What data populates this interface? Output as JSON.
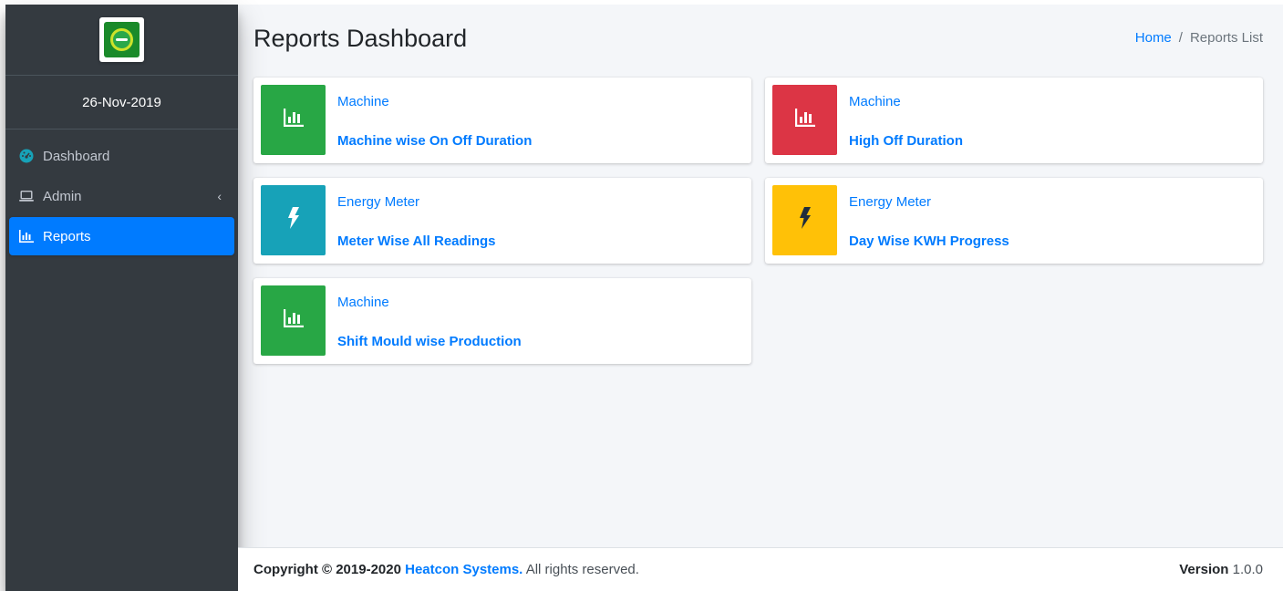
{
  "sidebar": {
    "logo_icon": "company-logo",
    "date": "26-Nov-2019",
    "items": [
      {
        "label": "Dashboard",
        "icon": "tachometer-icon"
      },
      {
        "label": "Admin",
        "icon": "laptop-icon"
      },
      {
        "label": "Reports",
        "icon": "bar-chart-icon"
      }
    ]
  },
  "header": {
    "title": "Reports Dashboard",
    "breadcrumb": {
      "home": "Home",
      "separator": "/",
      "current": "Reports List"
    }
  },
  "reports": [
    {
      "category": "Machine",
      "title": "Machine wise On Off Duration",
      "color": "#28a745",
      "icon": "bar-chart-icon"
    },
    {
      "category": "Machine",
      "title": "High Off Duration",
      "color": "#dc3545",
      "icon": "bar-chart-icon"
    },
    {
      "category": "Energy Meter",
      "title": "Meter Wise All Readings",
      "color": "#17a2b8",
      "icon": "bolt-icon"
    },
    {
      "category": "Energy Meter",
      "title": "Day Wise KWH Progress",
      "color": "#ffc107",
      "icon": "bolt-icon"
    },
    {
      "category": "Machine",
      "title": "Shift Mould wise Production",
      "color": "#28a745",
      "icon": "bar-chart-icon"
    }
  ],
  "footer": {
    "copyright": "Copyright © 2019-2020",
    "company": "Heatcon Systems.",
    "rights": "All rights reserved.",
    "version_label": "Version",
    "version": "1.0.0"
  }
}
